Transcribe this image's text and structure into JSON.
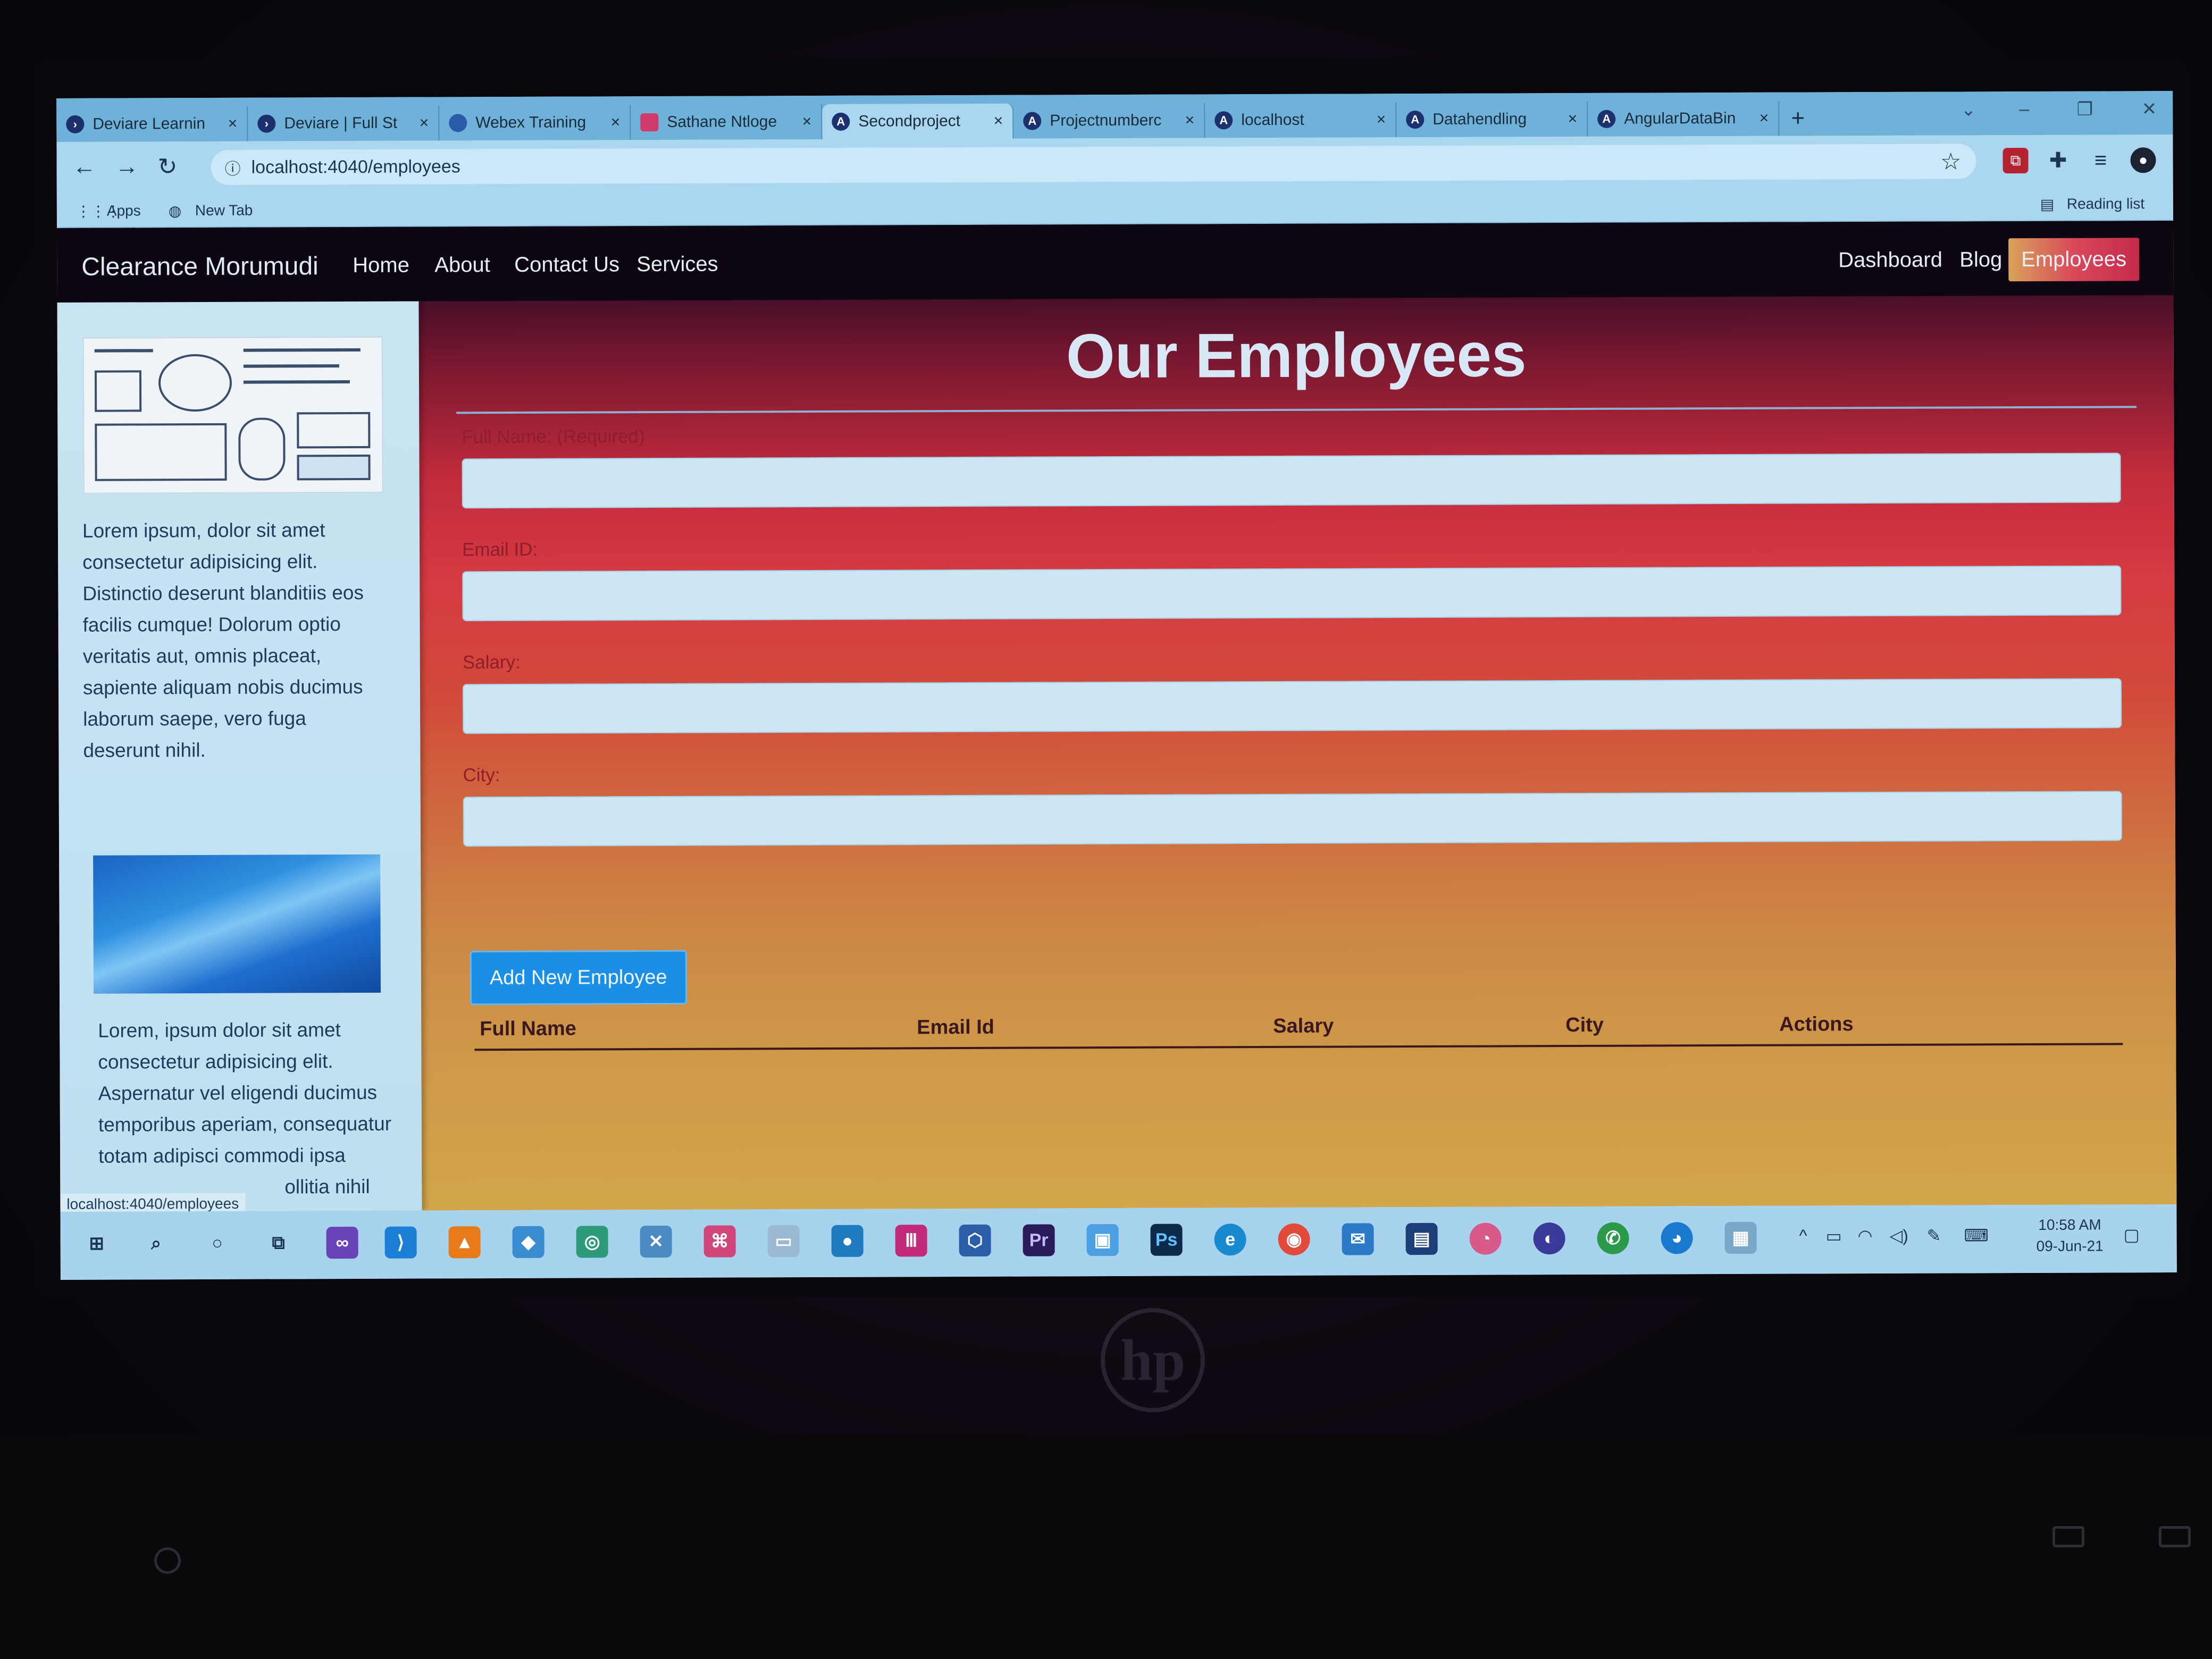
{
  "browser": {
    "tabs": [
      {
        "label": "Deviare Learnin",
        "icon": "deviare-icon"
      },
      {
        "label": "Deviare | Full St",
        "icon": "deviare-icon"
      },
      {
        "label": "Webex Training",
        "icon": "webex-icon"
      },
      {
        "label": "Sathane Ntloge",
        "icon": "app-icon"
      },
      {
        "label": "Secondproject",
        "icon": "angular-icon",
        "active": true
      },
      {
        "label": "Projectnumberc",
        "icon": "angular-icon"
      },
      {
        "label": "localhost",
        "icon": "angular-icon"
      },
      {
        "label": "Datahendling",
        "icon": "angular-icon"
      },
      {
        "label": "AngularDataBin",
        "icon": "angular-icon"
      }
    ],
    "tab_close": "×",
    "new_tab": "+",
    "url": "localhost:4040/employees",
    "bookmarks": {
      "apps": "Apps",
      "new_tab": "New Tab",
      "reading_list": "Reading list"
    },
    "status_url": "localhost:4040/employees"
  },
  "app": {
    "brand": "Clearance Morumudi",
    "nav_left": [
      "Home",
      "About",
      "Contact Us",
      "Services"
    ],
    "nav_right": [
      "Dashboard",
      "Blog",
      "Employees"
    ],
    "active_nav": "Employees",
    "sidebar": {
      "text1_lines": [
        "Lorem ipsum, dolor sit amet",
        "consectetur adipisicing elit.",
        "Distinctio deserunt blanditiis eos",
        "facilis cumque! Dolorum optio",
        "veritatis aut, omnis placeat,",
        "sapiente aliquam nobis ducimus",
        "laborum saepe, vero fuga",
        "deserunt nihil."
      ],
      "text2_lines": [
        "Lorem, ipsum dolor sit amet",
        "consectetur adipisicing elit.",
        "Aspernatur vel eligendi ducimus",
        "temporibus aperiam, consequatur",
        "totam adipisci commodi ipsa",
        "ollitia nihil"
      ]
    },
    "page_title": "Our Employees",
    "form": {
      "full_name_label": "Full Name: (Required)",
      "email_label": "Email ID:",
      "salary_label": "Salary:",
      "city_label": "City:",
      "full_name_value": "",
      "email_value": "",
      "salary_value": "",
      "city_value": "",
      "submit_label": "Add New Employee"
    },
    "table": {
      "headers": [
        "Full Name",
        "Email Id",
        "Salary",
        "City",
        "Actions"
      ],
      "rows": []
    }
  },
  "taskbar": {
    "time": "10:58 AM",
    "date": "09-Jun-21"
  },
  "colors": {
    "accent_button": "#1b8ee6",
    "nav_bar": "#0e0712",
    "gradient_top": "#7a1830",
    "gradient_mid": "#d63a42",
    "gradient_bottom": "#d3a64b"
  }
}
